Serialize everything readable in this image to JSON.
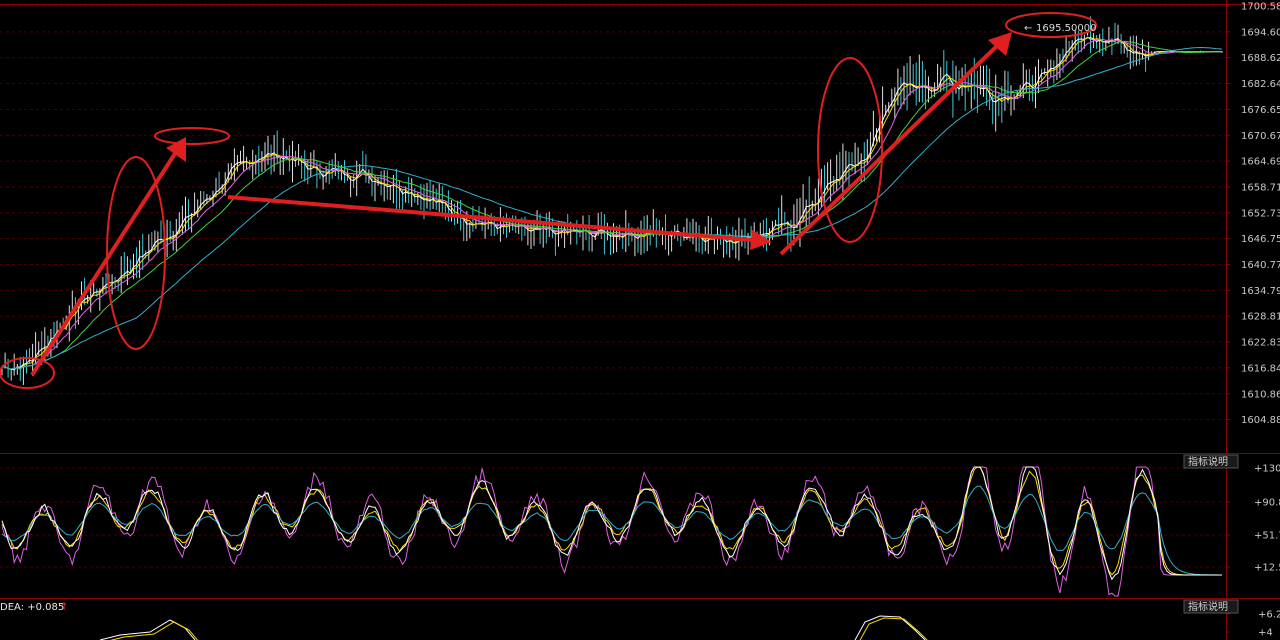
{
  "colors": {
    "background": "#000000",
    "axis_border": "#8b0000",
    "grid": "#4a0000",
    "up_candle": "#e0e0e0",
    "down_candle": "#40c8d8",
    "ma_white": "#ffffff",
    "ma_yellow": "#ffd700",
    "ma_magenta": "#e060e0",
    "ma_green": "#40d040",
    "ma_cyan": "#30b0c8",
    "annotation": "#e02020"
  },
  "main_panel": {
    "y_axis_ticks": [
      "1700.58",
      "1694.60",
      "1688.62",
      "1682.64",
      "1676.65",
      "1670.67",
      "1664.69",
      "1658.71",
      "1652.73",
      "1646.75",
      "1640.77",
      "1634.79",
      "1628.81",
      "1622.83",
      "1616.84",
      "1610.86",
      "1604.88"
    ],
    "peak_label": "1695.50000",
    "peak_arrow": "←"
  },
  "indicator_panel": {
    "button_label": "指标说明",
    "y_axis_ticks": [
      "+130",
      "+90.8",
      "+51.7",
      "+12.5"
    ]
  },
  "macd_panel": {
    "button_label": "指标说明",
    "dea_label": "DEA: +0.085",
    "dea_arrow": "↑",
    "y_axis_ticks": [
      "+6.2",
      "+4"
    ]
  },
  "chart_data": {
    "type": "line",
    "title": "",
    "y_range": [
      1599,
      1700.58
    ],
    "series": [
      {
        "values": [
          1617,
          1618,
          1625,
          1632,
          1636,
          1640,
          1646,
          1650,
          1656,
          1662,
          1666,
          1666,
          1663,
          1662,
          1662,
          1660,
          1658,
          1655,
          1652,
          1650,
          1649,
          1648,
          1648,
          1648,
          1648,
          1648,
          1648,
          1648,
          1647,
          1647,
          1648,
          1650,
          1656,
          1662,
          1666,
          1681,
          1682,
          1683,
          1683,
          1680,
          1681,
          1684,
          1692,
          1694,
          1692,
          1690,
          1690,
          1690,
          1690
        ]
      }
    ]
  }
}
